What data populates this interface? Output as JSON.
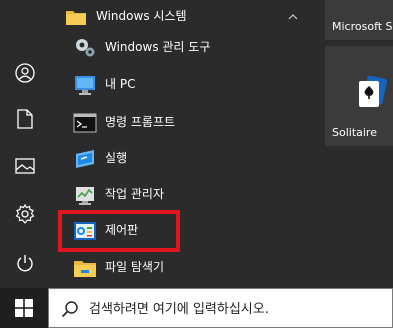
{
  "start_menu": {
    "group": {
      "label": "Windows 시스템",
      "expanded": true
    },
    "items": [
      {
        "label": "Windows 관리 도구",
        "icon": "admin-tools-icon"
      },
      {
        "label": "내 PC",
        "icon": "this-pc-icon"
      },
      {
        "label": "명령 프롬프트",
        "icon": "command-prompt-icon"
      },
      {
        "label": "실행",
        "icon": "run-icon"
      },
      {
        "label": "작업 관리자",
        "icon": "task-manager-icon"
      },
      {
        "label": "제어판",
        "icon": "control-panel-icon",
        "highlighted": true
      },
      {
        "label": "파일 탐색기",
        "icon": "file-explorer-icon"
      }
    ],
    "rail": [
      "user-icon",
      "documents-icon",
      "pictures-icon",
      "settings-icon",
      "power-icon"
    ]
  },
  "tiles": [
    {
      "label": "Microsoft S",
      "icon": "microsoft-store-icon"
    },
    {
      "label": "Solitaire",
      "icon": "solitaire-icon"
    }
  ],
  "taskbar": {
    "search_placeholder": "검색하려면 여기에 입력하십시오."
  },
  "colors": {
    "highlight": "#e0141e",
    "background": "#2b2b2b"
  }
}
